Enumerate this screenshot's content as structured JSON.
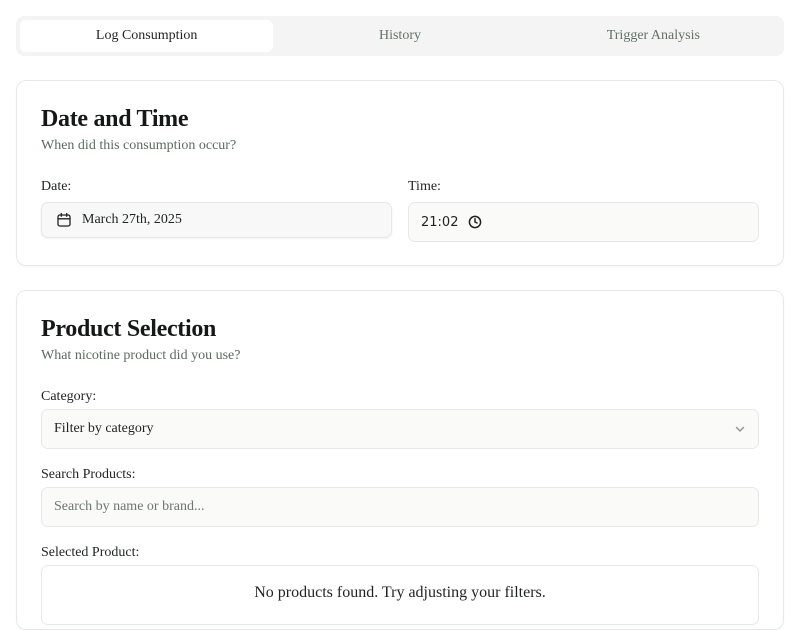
{
  "tabs": [
    {
      "label": "Log Consumption",
      "active": true
    },
    {
      "label": "History",
      "active": false
    },
    {
      "label": "Trigger Analysis",
      "active": false
    }
  ],
  "datetime_card": {
    "title": "Date and Time",
    "subtitle": "When did this consumption occur?",
    "date_label": "Date:",
    "date_value": "March 27th, 2025",
    "date_icon": "calendar-icon",
    "time_label": "Time:",
    "time_value": "21:02",
    "time_icon": "clock-icon"
  },
  "product_card": {
    "title": "Product Selection",
    "subtitle": "What nicotine product did you use?",
    "category_label": "Category:",
    "category_placeholder": "Filter by category",
    "category_icon": "chevron-down-icon",
    "search_label": "Search Products:",
    "search_placeholder": "Search by name or brand...",
    "selected_label": "Selected Product:",
    "empty_message": "No products found. Try adjusting your filters."
  },
  "colors": {
    "tab_bar_bg": "#f3f4f3",
    "muted_text": "#5b6a61",
    "border": "#e6e9e7"
  }
}
